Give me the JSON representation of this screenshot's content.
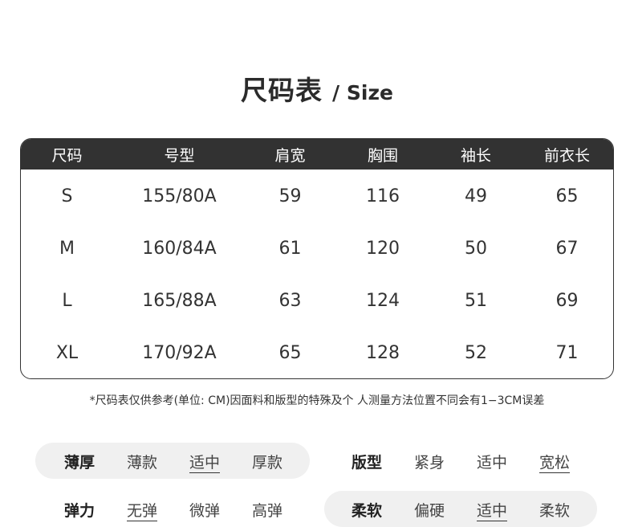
{
  "title": {
    "cn": "尺码表",
    "en": "/ Size"
  },
  "table": {
    "headers": [
      "尺码",
      "号型",
      "肩宽",
      "胸围",
      "袖长",
      "前衣长"
    ],
    "rows": [
      [
        "S",
        "155/80A",
        "59",
        "116",
        "49",
        "65"
      ],
      [
        "M",
        "160/84A",
        "61",
        "120",
        "50",
        "67"
      ],
      [
        "L",
        "165/88A",
        "63",
        "124",
        "51",
        "69"
      ],
      [
        "XL",
        "170/92A",
        "65",
        "128",
        "52",
        "71"
      ]
    ]
  },
  "note": "*尺码表仅供参考(单位: CM)因面料和版型的特殊及个 人测量方法位置不同会有1−3CM误差",
  "attributes": {
    "thickness": {
      "label": "薄厚",
      "options": [
        "薄款",
        "适中",
        "厚款"
      ],
      "selected": "适中"
    },
    "fit": {
      "label": "版型",
      "options": [
        "紧身",
        "适中",
        "宽松"
      ],
      "selected": "宽松"
    },
    "elasticity": {
      "label": "弹力",
      "options": [
        "无弹",
        "微弹",
        "高弹"
      ],
      "selected": "无弹"
    },
    "softness": {
      "label": "柔软",
      "options": [
        "偏硬",
        "适中",
        "柔软"
      ],
      "selected": "适中"
    }
  }
}
